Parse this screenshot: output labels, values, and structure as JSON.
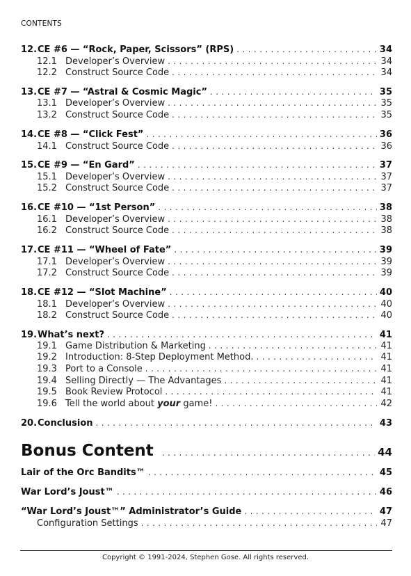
{
  "header": {
    "label": "CONTENTS"
  },
  "chapters": [
    {
      "num": "12.",
      "title": "CE #6 — “Rock, Paper, Scissors” (RPS)",
      "page": "34",
      "sections": [
        {
          "num": "12.1",
          "title": "Developer’s Overview",
          "page": "34"
        },
        {
          "num": "12.2",
          "title": "Construct Source Code",
          "page": "34"
        }
      ]
    },
    {
      "num": "13.",
      "title": "CE #7 — “Astral & Cosmic Magic”",
      "page": "35",
      "sections": [
        {
          "num": "13.1",
          "title": "Developer’s Overview",
          "page": "35"
        },
        {
          "num": "13.2",
          "title": "Construct Source Code",
          "page": "35"
        }
      ]
    },
    {
      "num": "14.",
      "title": "CE #8 — “Click Fest”",
      "page": "36",
      "sections": [
        {
          "num": "14.1",
          "title": "Construct Source Code",
          "page": "36"
        }
      ]
    },
    {
      "num": "15.",
      "title": "CE #9 — “En Gard”",
      "page": "37",
      "sections": [
        {
          "num": "15.1",
          "title": "Developer’s Overview",
          "page": "37"
        },
        {
          "num": "15.2",
          "title": "Construct Source Code",
          "page": "37"
        }
      ]
    },
    {
      "num": "16.",
      "title": "CE #10 — “1st Person”",
      "page": "38",
      "sections": [
        {
          "num": "16.1",
          "title": "Developer’s Overview",
          "page": "38"
        },
        {
          "num": "16.2",
          "title": "Construct Source Code",
          "page": "38"
        }
      ]
    },
    {
      "num": "17.",
      "title": "CE #11 — “Wheel of Fate”",
      "page": "39",
      "sections": [
        {
          "num": "17.1",
          "title": "Developer’s Overview",
          "page": "39"
        },
        {
          "num": "17.2",
          "title": "Construct Source Code",
          "page": "39"
        }
      ]
    },
    {
      "num": "18.",
      "title": "CE #12 — “Slot Machine”",
      "page": "40",
      "sections": [
        {
          "num": "18.1",
          "title": "Developer’s Overview",
          "page": "40"
        },
        {
          "num": "18.2",
          "title": "Construct Source Code",
          "page": "40"
        }
      ]
    },
    {
      "num": "19.",
      "title": "What’s next?",
      "page": "41",
      "sections": [
        {
          "num": "19.1",
          "title": "Game Distribution & Marketing",
          "page": "41"
        },
        {
          "num": "19.2",
          "title": "Introduction: 8-Step Deployment Method.",
          "page": "41"
        },
        {
          "num": "19.3",
          "title": "Port to a Console",
          "page": "41"
        },
        {
          "num": "19.4",
          "title": "Selling Directly — The Advantages",
          "page": "41"
        },
        {
          "num": "19.5",
          "title": "Book Review Protocol",
          "page": "41"
        },
        {
          "num": "19.6",
          "title_before": "Tell the world about ",
          "title_emphasis": "your",
          "title_after": " game!",
          "page": "42"
        }
      ]
    },
    {
      "num": "20.",
      "title": "Conclusion",
      "page": "43",
      "sections": []
    }
  ],
  "bonus": {
    "title": "Bonus Content",
    "page": "44",
    "items": [
      {
        "title": "Lair of the Orc Bandits™",
        "page": "45"
      },
      {
        "title": "War Lord’s Joust™",
        "page": "46"
      },
      {
        "title": "“War Lord’s Joust™” Administrator’s Guide",
        "page": "47",
        "sub": {
          "title": "Configuration Settings",
          "page": "47"
        }
      }
    ]
  },
  "footer": {
    "copyright": "Copyright © 1991-2024, Stephen Gose. All rights reserved."
  }
}
